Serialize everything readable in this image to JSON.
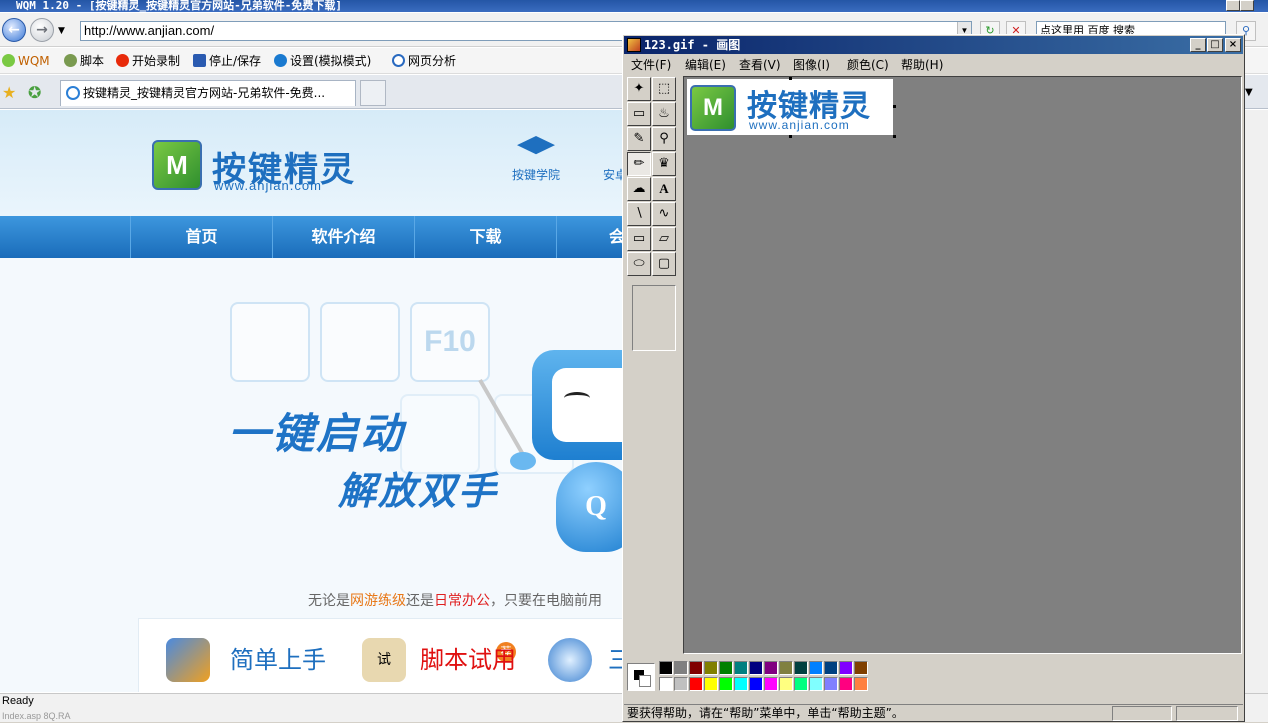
{
  "browser": {
    "title": "WQM 1.20 - [按键精灵_按键精灵官方网站-兄弟软件-免费下载]",
    "address": "http://www.anjian.com/",
    "search_text": "点这里用 百度 搜索",
    "tab_title": "按键精灵_按键精灵官方网站-兄弟软件-免费...",
    "toolbar": {
      "wqm": "WQM",
      "script": "脚本",
      "record": "开始录制",
      "stop_save": "停止/保存",
      "settings": "设置(模拟模式)",
      "analysis": "网页分析"
    },
    "status": "Ready",
    "status_faint": "Index.asp 8Q.RA"
  },
  "site": {
    "logo_cn": "按键精灵",
    "logo_url": "www.anjian.com",
    "logo_mark": "M",
    "school": "按键学院",
    "school2": "安卓",
    "nav": [
      "首页",
      "软件介绍",
      "下载",
      "会"
    ],
    "key_label": "F10",
    "slogan1": "一键启动",
    "slogan2": "解放双手",
    "robot_letter": "Q",
    "desc_pre": "无论是",
    "desc_hl1": "网游练级",
    "desc_mid": "还是",
    "desc_hl2": "日常办公",
    "desc_post": "，只要在电脑前用",
    "features": [
      "简单上手",
      "脚本试用",
      "三"
    ],
    "feature_badge": "试",
    "feature_tag": "荐"
  },
  "paint": {
    "title": "123.gif - 画图",
    "menu": [
      "文件(F)",
      "编辑(E)",
      "查看(V)",
      "图像(I)",
      "颜色(C)",
      "帮助(H)"
    ],
    "canvas_logo_cn": "按键精灵",
    "canvas_logo_url": "www.anjian.com",
    "canvas_logo_mark": "M",
    "status": "要获得帮助，请在“帮助”菜单中，单击“帮助主题”。",
    "palette_top": [
      "#000000",
      "#808080",
      "#800000",
      "#808000",
      "#008000",
      "#008080",
      "#000080",
      "#800080",
      "#808040",
      "#004040",
      "#0080ff",
      "#004080",
      "#8000ff",
      "#804000"
    ],
    "palette_bottom": [
      "#ffffff",
      "#c0c0c0",
      "#ff0000",
      "#ffff00",
      "#00ff00",
      "#00ffff",
      "#0000ff",
      "#ff00ff",
      "#ffff80",
      "#00ff80",
      "#80ffff",
      "#8080ff",
      "#ff0080",
      "#ff8040"
    ]
  }
}
